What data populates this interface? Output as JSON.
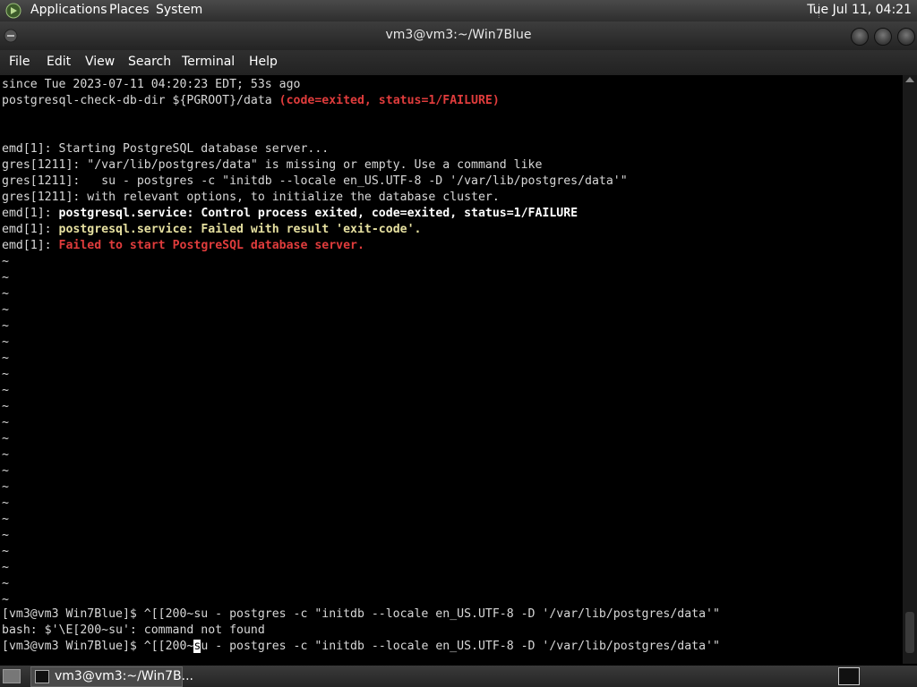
{
  "top_panel": {
    "applications": "Applications",
    "places": "Places",
    "system": "System",
    "clock": "Tue Jul 11, 04:21"
  },
  "window": {
    "title": "vm3@vm3:~/Win7Blue"
  },
  "menubar": [
    "File",
    "Edit",
    "View",
    "Search",
    "Terminal",
    "Help"
  ],
  "terminal": {
    "lines": [
      {
        "segments": [
          {
            "text": "since Tue 2023-07-11 04:20:23 EDT; 53s ago",
            "style": "normal"
          }
        ]
      },
      {
        "segments": [
          {
            "text": "postgresql-check-db-dir ${PGROOT}/data ",
            "style": "normal"
          },
          {
            "text": "(code=exited, status=1/FAILURE)",
            "style": "bold red"
          }
        ]
      },
      {
        "segments": [
          {
            "text": "",
            "style": "normal"
          }
        ]
      },
      {
        "segments": [
          {
            "text": "",
            "style": "normal"
          }
        ]
      },
      {
        "segments": [
          {
            "text": "emd[1]: Starting PostgreSQL database server...",
            "style": "normal"
          }
        ]
      },
      {
        "segments": [
          {
            "text": "gres[1211]: \"/var/lib/postgres/data\" is missing or empty. Use a command like",
            "style": "normal"
          }
        ]
      },
      {
        "segments": [
          {
            "text": "gres[1211]:   su - postgres -c \"initdb --locale en_US.UTF-8 -D '/var/lib/postgres/data'\"",
            "style": "normal"
          }
        ]
      },
      {
        "segments": [
          {
            "text": "gres[1211]: with relevant options, to initialize the database cluster.",
            "style": "normal"
          }
        ]
      },
      {
        "segments": [
          {
            "text": "emd[1]: ",
            "style": "normal"
          },
          {
            "text": "postgresql.service: Control process exited, code=exited, status=1/FAILURE",
            "style": "bold white"
          }
        ]
      },
      {
        "segments": [
          {
            "text": "emd[1]: ",
            "style": "normal"
          },
          {
            "text": "postgresql.service: Failed with result 'exit-code'.",
            "style": "bold yellow"
          }
        ]
      },
      {
        "segments": [
          {
            "text": "emd[1]: ",
            "style": "normal"
          },
          {
            "text": "Failed to start PostgreSQL database server.",
            "style": "bold red"
          }
        ]
      }
    ],
    "tilde": "~",
    "tilde_count": 22,
    "prompt_lines": [
      "[vm3@vm3 Win7Blue]$ ^[[200~su - postgres -c \"initdb --locale en_US.UTF-8 -D '/var/lib/postgres/data'\"",
      "bash: $'\\E[200~su': command not found"
    ],
    "last_prompt_before": "[vm3@vm3 Win7Blue]$ ^[[200~",
    "last_prompt_cursor": "s",
    "last_prompt_after": "u - postgres -c \"initdb --locale en_US.UTF-8 -D '/var/lib/postgres/data'\""
  },
  "taskbar": {
    "task_label": "vm3@vm3:~/Win7B..."
  }
}
